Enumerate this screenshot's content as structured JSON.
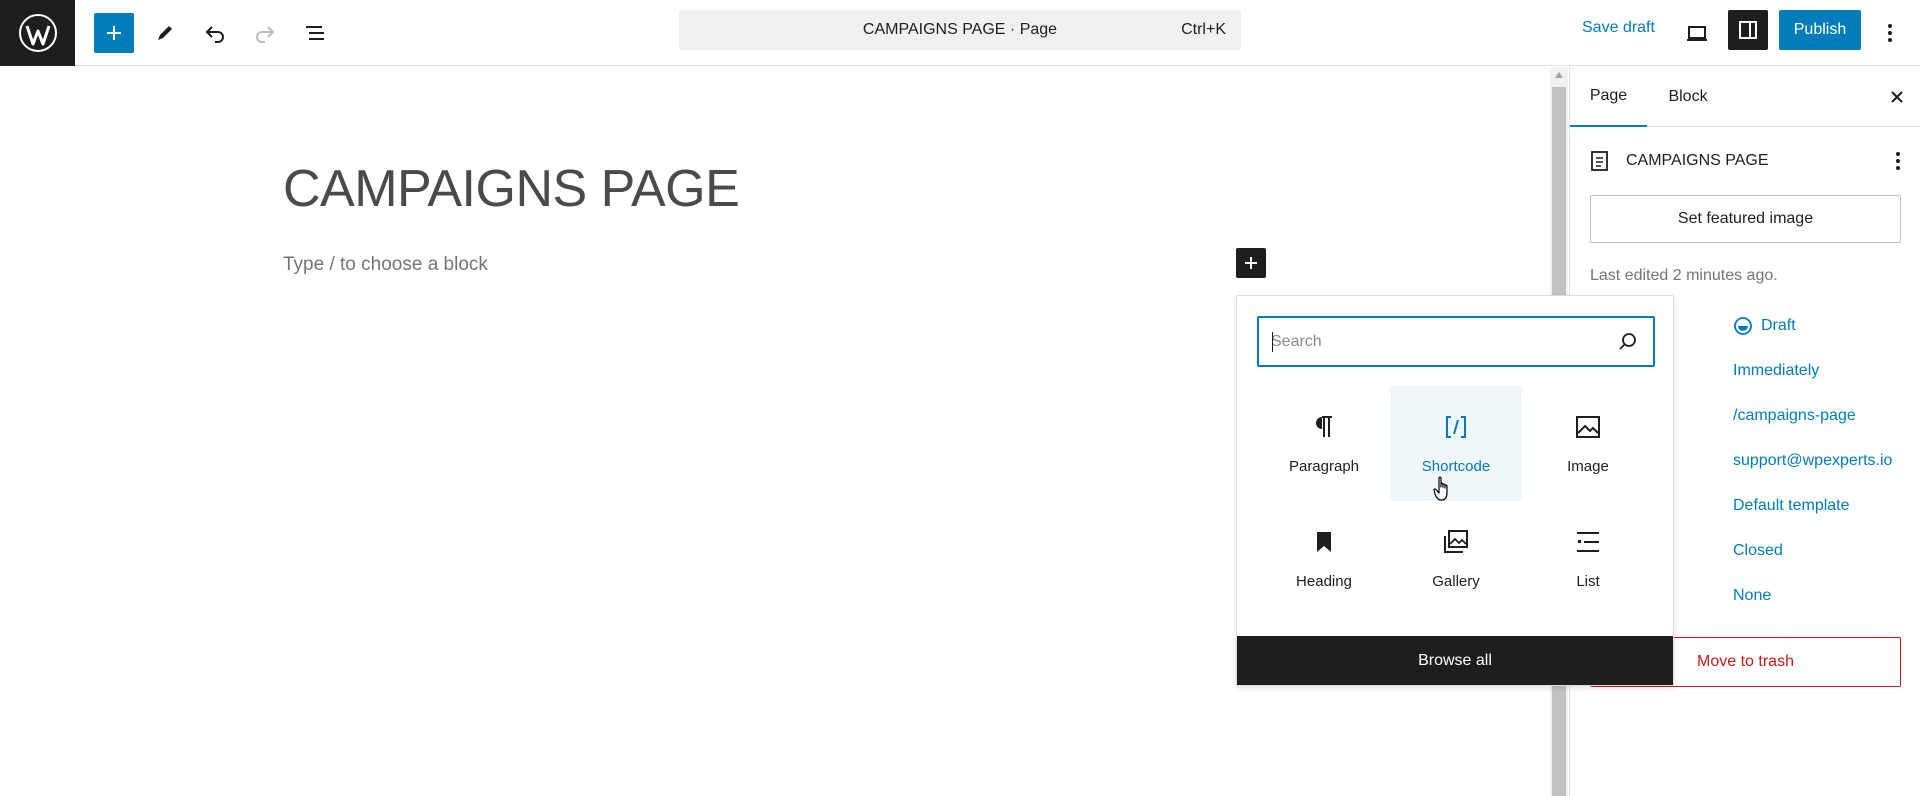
{
  "topbar": {
    "command_bar_title": "CAMPAIGNS PAGE · Page",
    "command_bar_shortcut": "Ctrl+K",
    "save_draft_label": "Save draft",
    "publish_label": "Publish"
  },
  "editor": {
    "page_title": "CAMPAIGNS PAGE",
    "block_placeholder": "Type / to choose a block"
  },
  "sidebar": {
    "tabs": [
      {
        "label": "Page",
        "active": true
      },
      {
        "label": "Block",
        "active": false
      }
    ],
    "document_title": "CAMPAIGNS PAGE",
    "featured_image_label": "Set featured image",
    "last_edited": "Last edited 2 minutes ago.",
    "properties": {
      "status": "Draft",
      "publish": "Immediately",
      "link": "/campaigns-page",
      "author": "support@wpexperts.io",
      "template": "Default template",
      "discussion": "Closed",
      "parent": "None"
    },
    "trash_label": "Move to trash"
  },
  "inserter": {
    "search_placeholder": "Search",
    "blocks": [
      {
        "label": "Paragraph",
        "icon": "paragraph-icon"
      },
      {
        "label": "Shortcode",
        "icon": "shortcode-icon",
        "hovered": true
      },
      {
        "label": "Image",
        "icon": "image-icon"
      },
      {
        "label": "Heading",
        "icon": "heading-icon"
      },
      {
        "label": "Gallery",
        "icon": "gallery-icon"
      },
      {
        "label": "List",
        "icon": "list-icon"
      }
    ],
    "browse_all_label": "Browse all"
  },
  "colors": {
    "accent": "#007cba",
    "dark": "#1e1e1e",
    "danger": "#cc1818"
  }
}
